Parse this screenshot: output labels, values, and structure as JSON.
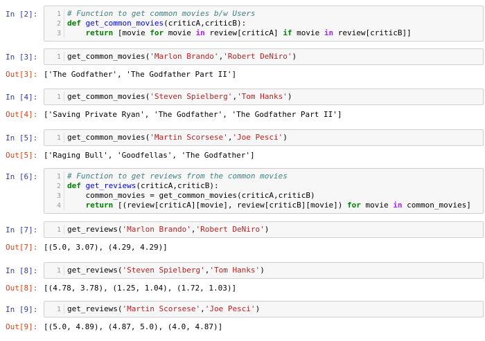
{
  "cells": [
    {
      "in_prompt": "In [2]:",
      "lines": [
        [
          {
            "t": "# Function to get common movies b/w Users",
            "c": "c"
          }
        ],
        [
          {
            "t": "def ",
            "c": "k"
          },
          {
            "t": "get_common_movies",
            "c": "f"
          },
          {
            "t": "(criticA,criticB):",
            "c": ""
          }
        ],
        [
          {
            "t": "    ",
            "c": ""
          },
          {
            "t": "return",
            "c": "k"
          },
          {
            "t": " [movie ",
            "c": ""
          },
          {
            "t": "for",
            "c": "k"
          },
          {
            "t": " movie ",
            "c": ""
          },
          {
            "t": "in",
            "c": "o"
          },
          {
            "t": " review[criticA] ",
            "c": ""
          },
          {
            "t": "if",
            "c": "k"
          },
          {
            "t": " movie ",
            "c": ""
          },
          {
            "t": "in",
            "c": "o"
          },
          {
            "t": " review[criticB]]",
            "c": ""
          }
        ]
      ],
      "out_prompt": "",
      "output": ""
    },
    {
      "in_prompt": "In [3]:",
      "lines": [
        [
          {
            "t": "get_common_movies(",
            "c": ""
          },
          {
            "t": "'Marlon Brando'",
            "c": "s"
          },
          {
            "t": ",",
            "c": ""
          },
          {
            "t": "'Robert DeNiro'",
            "c": "s"
          },
          {
            "t": ")",
            "c": ""
          }
        ]
      ],
      "out_prompt": "Out[3]:",
      "output": "['The Godfather', 'The Godfather Part II']"
    },
    {
      "in_prompt": "In [4]:",
      "lines": [
        [
          {
            "t": "get_common_movies(",
            "c": ""
          },
          {
            "t": "'Steven Spielberg'",
            "c": "s"
          },
          {
            "t": ",",
            "c": ""
          },
          {
            "t": "'Tom Hanks'",
            "c": "s"
          },
          {
            "t": ")",
            "c": ""
          }
        ]
      ],
      "out_prompt": "Out[4]:",
      "output": "['Saving Private Ryan', 'The Godfather', 'The Godfather Part II']"
    },
    {
      "in_prompt": "In [5]:",
      "lines": [
        [
          {
            "t": "get_common_movies(",
            "c": ""
          },
          {
            "t": "'Martin Scorsese'",
            "c": "s"
          },
          {
            "t": ",",
            "c": ""
          },
          {
            "t": "'Joe Pesci'",
            "c": "s"
          },
          {
            "t": ")",
            "c": ""
          }
        ]
      ],
      "out_prompt": "Out[5]:",
      "output": "['Raging Bull', 'Goodfellas', 'The Godfather']"
    },
    {
      "in_prompt": "In [6]:",
      "lines": [
        [
          {
            "t": "# Function to get reviews from the common movies",
            "c": "c"
          }
        ],
        [
          {
            "t": "def ",
            "c": "k"
          },
          {
            "t": "get_reviews",
            "c": "f"
          },
          {
            "t": "(criticA,criticB):",
            "c": ""
          }
        ],
        [
          {
            "t": "    common_movies = get_common_movies(criticA,criticB)",
            "c": ""
          }
        ],
        [
          {
            "t": "    ",
            "c": ""
          },
          {
            "t": "return",
            "c": "k"
          },
          {
            "t": " [(review[criticA][movie], review[criticB][movie]) ",
            "c": ""
          },
          {
            "t": "for",
            "c": "k"
          },
          {
            "t": " movie ",
            "c": ""
          },
          {
            "t": "in",
            "c": "o"
          },
          {
            "t": " common_movies]",
            "c": ""
          }
        ]
      ],
      "out_prompt": "",
      "output": ""
    },
    {
      "in_prompt": "In [7]:",
      "lines": [
        [
          {
            "t": "get_reviews(",
            "c": ""
          },
          {
            "t": "'Marlon Brando'",
            "c": "s"
          },
          {
            "t": ",",
            "c": ""
          },
          {
            "t": "'Robert DeNiro'",
            "c": "s"
          },
          {
            "t": ")",
            "c": ""
          }
        ]
      ],
      "out_prompt": "Out[7]:",
      "output": "[(5.0, 3.07), (4.29, 4.29)]"
    },
    {
      "in_prompt": "In [8]:",
      "lines": [
        [
          {
            "t": "get_reviews(",
            "c": ""
          },
          {
            "t": "'Steven Spielberg'",
            "c": "s"
          },
          {
            "t": ",",
            "c": ""
          },
          {
            "t": "'Tom Hanks'",
            "c": "s"
          },
          {
            "t": ")",
            "c": ""
          }
        ]
      ],
      "out_prompt": "Out[8]:",
      "output": "[(4.78, 3.78), (1.25, 1.04), (1.72, 1.03)]"
    },
    {
      "in_prompt": "In [9]:",
      "lines": [
        [
          {
            "t": "get_reviews(",
            "c": ""
          },
          {
            "t": "'Martin Scorsese'",
            "c": "s"
          },
          {
            "t": ",",
            "c": ""
          },
          {
            "t": "'Joe Pesci'",
            "c": "s"
          },
          {
            "t": ")",
            "c": ""
          }
        ]
      ],
      "out_prompt": "Out[9]:",
      "output": "[(5.0, 4.89), (4.87, 5.0), (4.0, 4.87)]"
    }
  ]
}
